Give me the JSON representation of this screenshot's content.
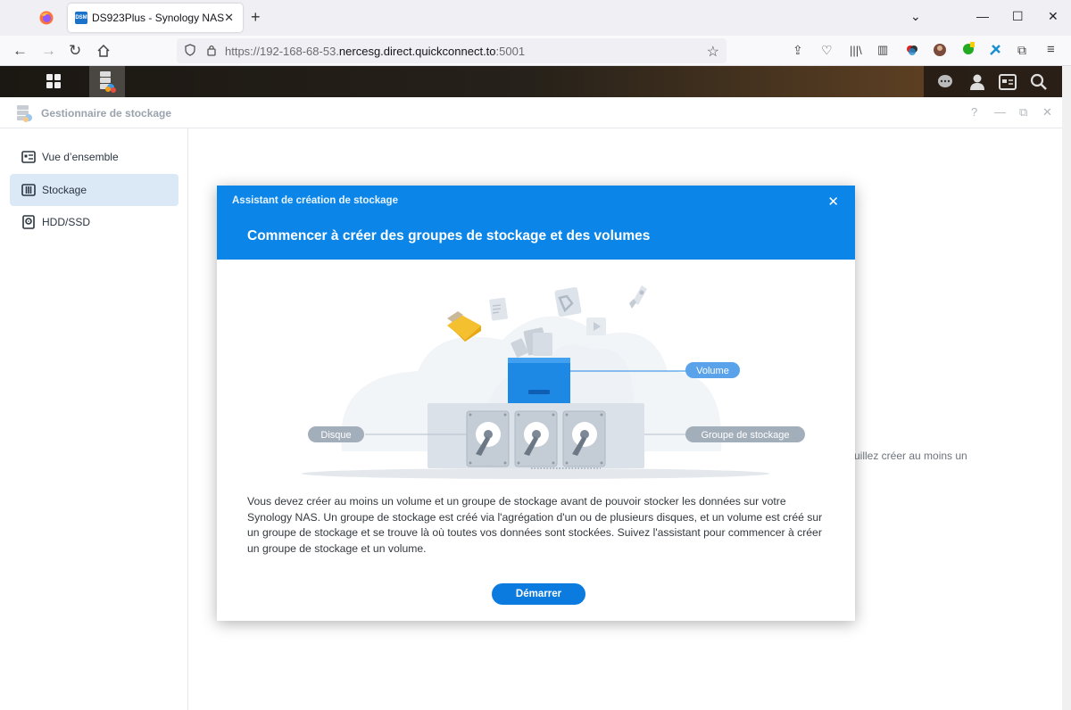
{
  "browser": {
    "tab_title": "DS923Plus - Synology NAS",
    "tab_favicon_text": "DSM",
    "url_host": "https://192-168-68-53.",
    "url_domain": "nercesg.direct.quickconnect.to",
    "url_port": ":5001"
  },
  "app": {
    "title": "Gestionnaire de stockage",
    "help": "?",
    "sidebar": [
      {
        "label": "Vue d’ensemble",
        "icon": "overview-icon"
      },
      {
        "label": "Stockage",
        "icon": "storage-icon"
      },
      {
        "label": "HDD/SSD",
        "icon": "hdd-icon"
      }
    ],
    "background_text": "uillez créer au moins un"
  },
  "wizard": {
    "title": "Assistant de création de stockage",
    "heading": "Commencer à créer des groupes de stockage et des volumes",
    "labels": {
      "volume": "Volume",
      "disk": "Disque",
      "pool": "Groupe de stockage"
    },
    "description": "Vous devez créer au moins un volume et un groupe de stockage avant de pouvoir stocker les données sur votre Synology NAS. Un groupe de stockage est créé via l'agrégation d'un ou de plusieurs disques, et un volume est créé sur un groupe de stockage et se trouve là où toutes vos données sont stockées. Suivez l'assistant pour commencer à créer un groupe de stockage et un volume.",
    "start_button": "Démarrer"
  },
  "colors": {
    "accent": "#0b86e8",
    "button": "#0b7be0",
    "sidebar_active": "#dbe9f7"
  }
}
